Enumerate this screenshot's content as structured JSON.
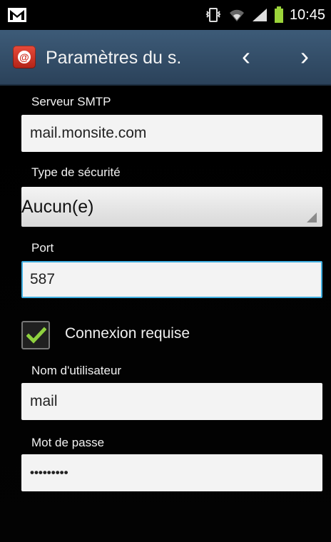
{
  "status_bar": {
    "time": "10:45",
    "icons": [
      "gmail-icon",
      "vibrate-icon",
      "wifi-icon",
      "signal-icon",
      "battery-icon"
    ]
  },
  "action_bar": {
    "title": "Paramètres du s.",
    "prev_icon": "chevron-left-icon",
    "next_icon": "chevron-right-icon",
    "app_icon": "email-app-icon"
  },
  "form": {
    "smtp_server": {
      "label": "Serveur SMTP",
      "value": "mail.monsite.com"
    },
    "security_type": {
      "label": "Type de sécurité",
      "value": "Aucun(e)"
    },
    "port": {
      "label": "Port",
      "value": "587"
    },
    "login_required": {
      "label": "Connexion requise",
      "checked": true
    },
    "username": {
      "label": "Nom d'utilisateur",
      "value": "mail"
    },
    "password": {
      "label": "Mot de passe",
      "value": "•••••••••"
    }
  },
  "colors": {
    "action_bar": "#34506d",
    "focus_border": "#3faee0",
    "check_green": "#8fd13f"
  }
}
